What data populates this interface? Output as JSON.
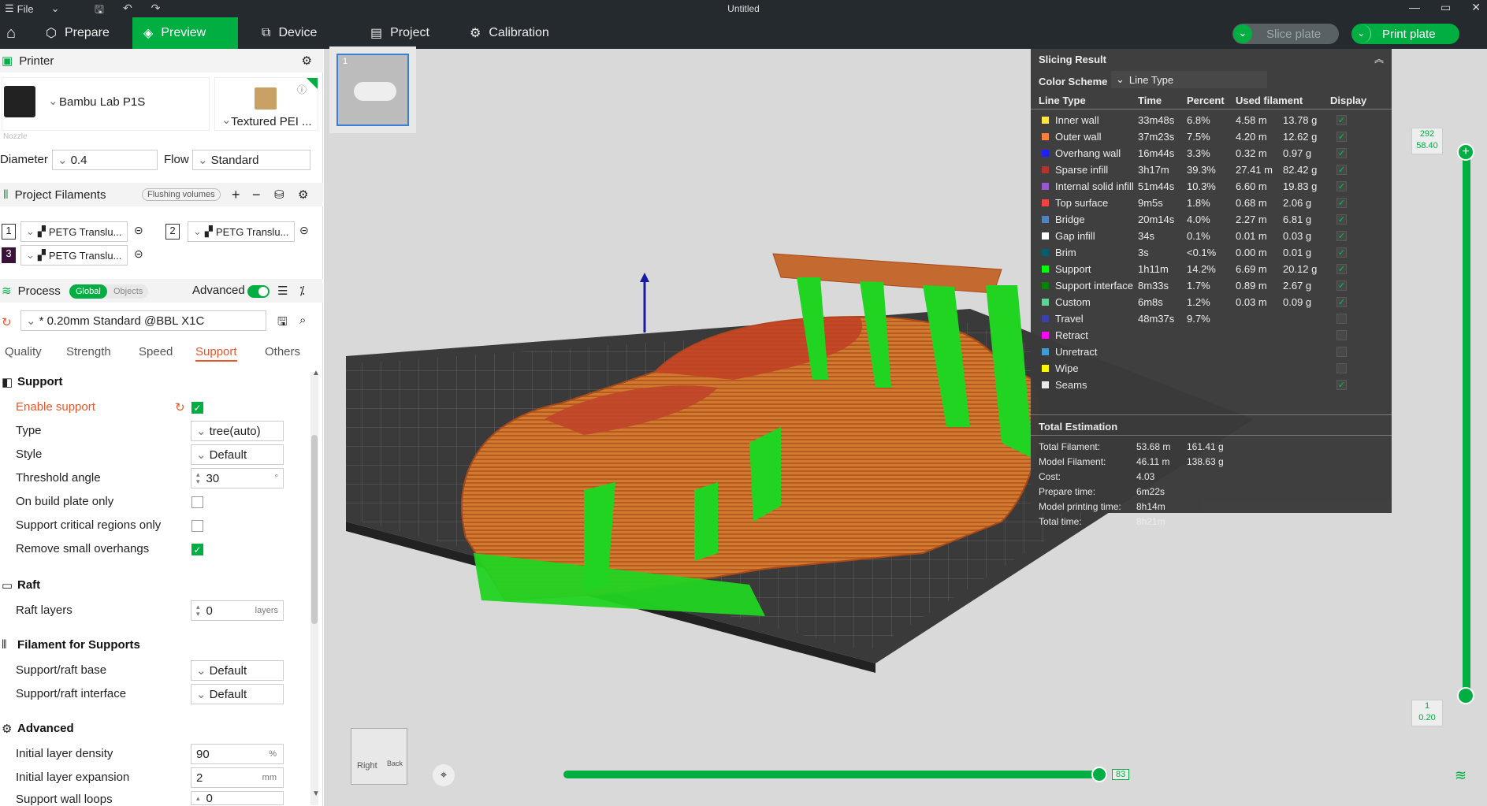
{
  "titlebar": {
    "file_label": "File",
    "title": "Untitled"
  },
  "nav": {
    "tabs": [
      {
        "label": "Prepare"
      },
      {
        "label": "Preview"
      },
      {
        "label": "Device"
      },
      {
        "label": "Project"
      },
      {
        "label": "Calibration"
      }
    ],
    "slice_label": "Slice plate",
    "print_label": "Print plate"
  },
  "printer": {
    "section_title": "Printer",
    "name": "Bambu Lab P1S",
    "plate": "Textured PEI ...",
    "nozzle_label": "Nozzle",
    "diameter_label": "Diameter",
    "diameter_value": "0.4",
    "flow_label": "Flow",
    "flow_value": "Standard"
  },
  "filaments": {
    "section_title": "Project Filaments",
    "flushing_label": "Flushing volumes",
    "items": [
      {
        "index": "1",
        "name": "PETG Translu..."
      },
      {
        "index": "2",
        "name": "PETG Translu..."
      },
      {
        "index": "3",
        "name": "PETG Translu..."
      }
    ]
  },
  "process": {
    "section_title": "Process",
    "global_label": "Global",
    "objects_label": "Objects",
    "advanced_label": "Advanced",
    "preset": "* 0.20mm Standard @BBL X1C",
    "tabs": [
      "Quality",
      "Strength",
      "Speed",
      "Support",
      "Others"
    ],
    "active_tab": "Support"
  },
  "support": {
    "group_title": "Support",
    "enable_label": "Enable support",
    "type_label": "Type",
    "type_value": "tree(auto)",
    "style_label": "Style",
    "style_value": "Default",
    "threshold_label": "Threshold angle",
    "threshold_value": "30",
    "threshold_unit": "°",
    "build_plate_label": "On build plate only",
    "critical_label": "Support critical regions only",
    "remove_small_label": "Remove small overhangs",
    "enable_checked": true,
    "build_plate_checked": false,
    "critical_checked": false,
    "remove_small_checked": true
  },
  "raft": {
    "group_title": "Raft",
    "layers_label": "Raft layers",
    "layers_value": "0",
    "layers_unit": "layers"
  },
  "filament_supports": {
    "group_title": "Filament for Supports",
    "base_label": "Support/raft base",
    "base_value": "Default",
    "interface_label": "Support/raft interface",
    "interface_value": "Default"
  },
  "advanced": {
    "group_title": "Advanced",
    "density_label": "Initial layer density",
    "density_value": "90",
    "density_unit": "%",
    "expansion_label": "Initial layer expansion",
    "expansion_value": "2",
    "expansion_unit": "mm",
    "wall_loops_label": "Support wall loops",
    "wall_loops_value": "0"
  },
  "plate_thumb": {
    "index": "1"
  },
  "slicing": {
    "title": "Slicing Result",
    "color_scheme_label": "Color Scheme",
    "color_scheme_value": "Line Type",
    "headers": [
      "Line Type",
      "Time",
      "Percent",
      "Used filament",
      "Display"
    ],
    "rows": [
      {
        "name": "Inner wall",
        "color": "#ffe640",
        "time": "33m48s",
        "percent": "6.8%",
        "length": "4.58 m",
        "weight": "13.78 g",
        "display": true
      },
      {
        "name": "Outer wall",
        "color": "#ff7d38",
        "time": "37m23s",
        "percent": "7.5%",
        "length": "4.20 m",
        "weight": "12.62 g",
        "display": true
      },
      {
        "name": "Overhang wall",
        "color": "#1919ff",
        "time": "16m44s",
        "percent": "3.3%",
        "length": "0.32 m",
        "weight": "0.97 g",
        "display": true
      },
      {
        "name": "Sparse infill",
        "color": "#b03029",
        "time": "3h17m",
        "percent": "39.3%",
        "length": "27.41 m",
        "weight": "82.42 g",
        "display": true
      },
      {
        "name": "Internal solid infill",
        "color": "#9654cc",
        "time": "51m44s",
        "percent": "10.3%",
        "length": "6.60 m",
        "weight": "19.83 g",
        "display": true
      },
      {
        "name": "Top surface",
        "color": "#f04040",
        "time": "9m5s",
        "percent": "1.8%",
        "length": "0.68 m",
        "weight": "2.06 g",
        "display": true
      },
      {
        "name": "Bridge",
        "color": "#4d80ba",
        "time": "20m14s",
        "percent": "4.0%",
        "length": "2.27 m",
        "weight": "6.81 g",
        "display": true
      },
      {
        "name": "Gap infill",
        "color": "#ffffff",
        "time": "34s",
        "percent": "0.1%",
        "length": "0.01 m",
        "weight": "0.03 g",
        "display": true
      },
      {
        "name": "Brim",
        "color": "#00596b",
        "time": "3s",
        "percent": "<0.1%",
        "length": "0.00 m",
        "weight": "0.01 g",
        "display": true
      },
      {
        "name": "Support",
        "color": "#00ff00",
        "time": "1h11m",
        "percent": "14.2%",
        "length": "6.69 m",
        "weight": "20.12 g",
        "display": true
      },
      {
        "name": "Support interface",
        "color": "#008000",
        "time": "8m33s",
        "percent": "1.7%",
        "length": "0.89 m",
        "weight": "2.67 g",
        "display": true
      },
      {
        "name": "Custom",
        "color": "#5ed194",
        "time": "6m8s",
        "percent": "1.2%",
        "length": "0.03 m",
        "weight": "0.09 g",
        "display": true
      },
      {
        "name": "Travel",
        "color": "#383ca8",
        "time": "48m37s",
        "percent": "9.7%",
        "length": "",
        "weight": "",
        "display": false
      },
      {
        "name": "Retract",
        "color": "#ff00ff",
        "time": "",
        "percent": "",
        "length": "",
        "weight": "",
        "display": false
      },
      {
        "name": "Unretract",
        "color": "#40a0d8",
        "time": "",
        "percent": "",
        "length": "",
        "weight": "",
        "display": false
      },
      {
        "name": "Wipe",
        "color": "#ffff00",
        "time": "",
        "percent": "",
        "length": "",
        "weight": "",
        "display": false
      },
      {
        "name": "Seams",
        "color": "#f0f0f0",
        "time": "",
        "percent": "",
        "length": "",
        "weight": "",
        "display": true
      }
    ],
    "total_title": "Total Estimation",
    "totals": [
      {
        "label": "Total Filament:",
        "value": "53.68 m",
        "value2": "161.41 g"
      },
      {
        "label": "Model Filament:",
        "value": "46.11 m",
        "value2": "138.63 g"
      },
      {
        "label": "Cost:",
        "value": "4.03",
        "value2": ""
      },
      {
        "label": "Prepare time:",
        "value": "6m22s",
        "value2": ""
      },
      {
        "label": "Model printing time:",
        "value": "8h14m",
        "value2": ""
      },
      {
        "label": "Total time:",
        "value": "8h21m",
        "value2": ""
      }
    ]
  },
  "layer_slider": {
    "top_layer": "292",
    "top_height": "58.40",
    "bottom_layer": "1",
    "bottom_height": "0.20"
  },
  "move_slider": {
    "value": "83"
  },
  "view_cube": {
    "right_label": "Right",
    "back_label": "Back"
  },
  "colors": {
    "accent": "#00ae42",
    "nav_bg": "#242a2e",
    "active_tab_text": "#e8552b"
  }
}
